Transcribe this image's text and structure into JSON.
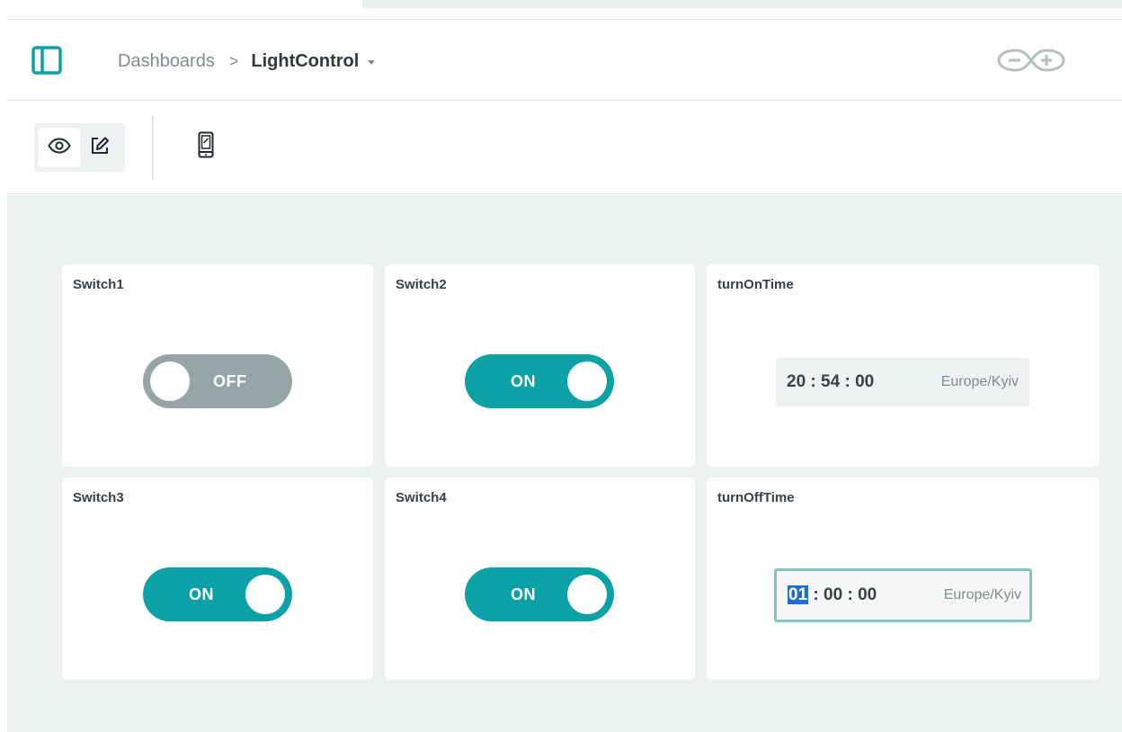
{
  "header": {
    "breadcrumb_root": "Dashboards",
    "breadcrumb_separator": ">",
    "dashboard_name": "LightControl"
  },
  "toolbar": {
    "view_mode_icon": "eye-icon",
    "edit_mode_icon": "pencil-icon",
    "mobile_view_icon": "mobile-phone-icon",
    "active_mode": "view"
  },
  "widgets": {
    "switch1": {
      "title": "Switch1",
      "state": "OFF"
    },
    "switch2": {
      "title": "Switch2",
      "state": "ON"
    },
    "switch3": {
      "title": "Switch3",
      "state": "ON"
    },
    "switch4": {
      "title": "Switch4",
      "state": "ON"
    },
    "turn_on_time": {
      "title": "turnOnTime",
      "hh": "20",
      "mm": "54",
      "ss": "00",
      "timezone": "Europe/Kyiv"
    },
    "turn_off_time": {
      "title": "turnOffTime",
      "hh": "01",
      "mm": "00",
      "ss": "00",
      "timezone": "Europe/Kyiv"
    }
  },
  "colors": {
    "accent": "#0ca1a6",
    "toggle_off": "#95a5a6",
    "canvas_bg": "#ecf1f1",
    "selection": "#1f6fd1"
  }
}
